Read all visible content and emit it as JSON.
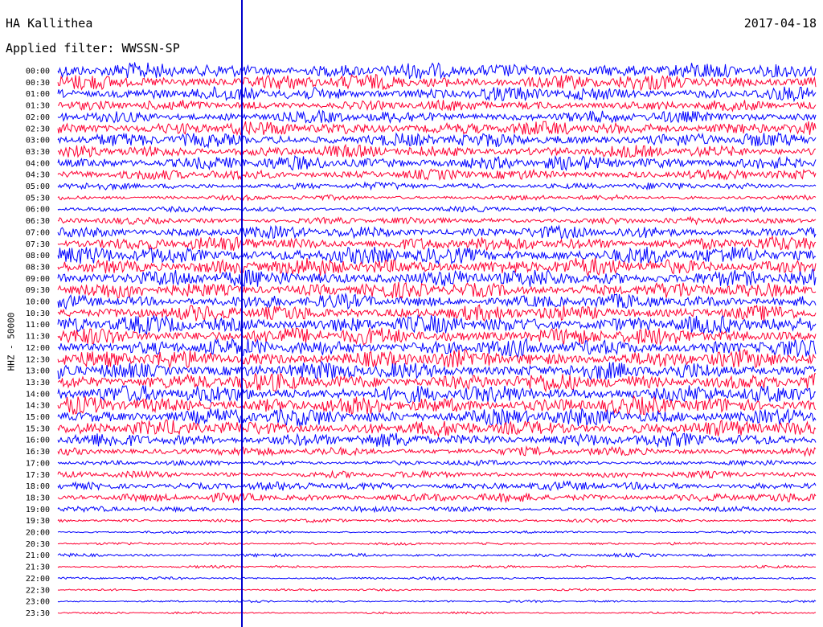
{
  "header": {
    "station": "HA Kallithea",
    "date": "2017-04-18",
    "filter": "Applied filter: WWSSN-SP"
  },
  "chart_data": {
    "type": "line",
    "title": "HA Kallithea",
    "ylabel": "HHZ - 50000",
    "row_labels": [
      "00:00",
      "00:30",
      "01:00",
      "01:30",
      "02:00",
      "02:30",
      "03:00",
      "03:30",
      "04:00",
      "04:30",
      "05:00",
      "05:30",
      "06:00",
      "06:30",
      "07:00",
      "07:30",
      "08:00",
      "08:30",
      "09:00",
      "09:30",
      "10:00",
      "10:30",
      "11:00",
      "11:30",
      "12:00",
      "12:30",
      "13:00",
      "13:30",
      "14:00",
      "14:30",
      "15:00",
      "15:30",
      "16:00",
      "16:30",
      "17:00",
      "17:30",
      "18:00",
      "18:30",
      "19:00",
      "19:30",
      "20:00",
      "20:30",
      "21:00",
      "21:30",
      "22:00",
      "22:30",
      "23:00",
      "23:30"
    ],
    "trace_colors": [
      "#0000ff",
      "#ff0033"
    ],
    "marker_color": "#0000cc",
    "relative_amplitude": [
      0.9,
      0.9,
      0.8,
      0.6,
      0.7,
      0.8,
      0.8,
      0.7,
      0.8,
      0.6,
      0.4,
      0.3,
      0.3,
      0.4,
      0.7,
      0.8,
      1.0,
      1.0,
      1.0,
      0.9,
      0.8,
      0.9,
      1.0,
      1.0,
      1.0,
      1.0,
      1.0,
      1.0,
      1.0,
      1.0,
      1.0,
      0.9,
      0.8,
      0.5,
      0.3,
      0.4,
      0.5,
      0.5,
      0.3,
      0.2,
      0.15,
      0.15,
      0.2,
      0.15,
      0.15,
      0.12,
      0.12,
      0.12
    ]
  }
}
